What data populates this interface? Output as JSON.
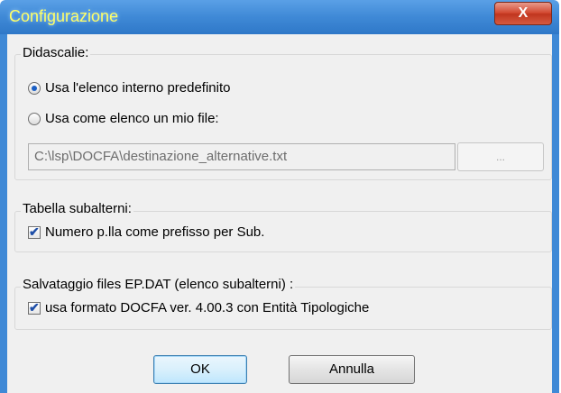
{
  "window": {
    "title": "Configurazione",
    "close_label": "X"
  },
  "didascalie": {
    "legend": "Didascalie:",
    "option_internal": "Usa l'elenco interno predefinito",
    "option_file": "Usa come elenco un mio file:",
    "selected": "option_internal",
    "file_path": "C:\\lsp\\DOCFA\\destinazione_alternative.txt",
    "browse_label": "..."
  },
  "tabella": {
    "legend": "Tabella subalterni:",
    "checkbox_label": "Numero p.lla come prefisso per Sub.",
    "checked": true
  },
  "salvataggio": {
    "legend": "Salvataggio files EP.DAT (elenco subalterni) :",
    "checkbox_label": "usa formato DOCFA ver. 4.00.3 con Entità Tipologiche",
    "checked": true
  },
  "buttons": {
    "ok": "OK",
    "cancel": "Annulla"
  }
}
